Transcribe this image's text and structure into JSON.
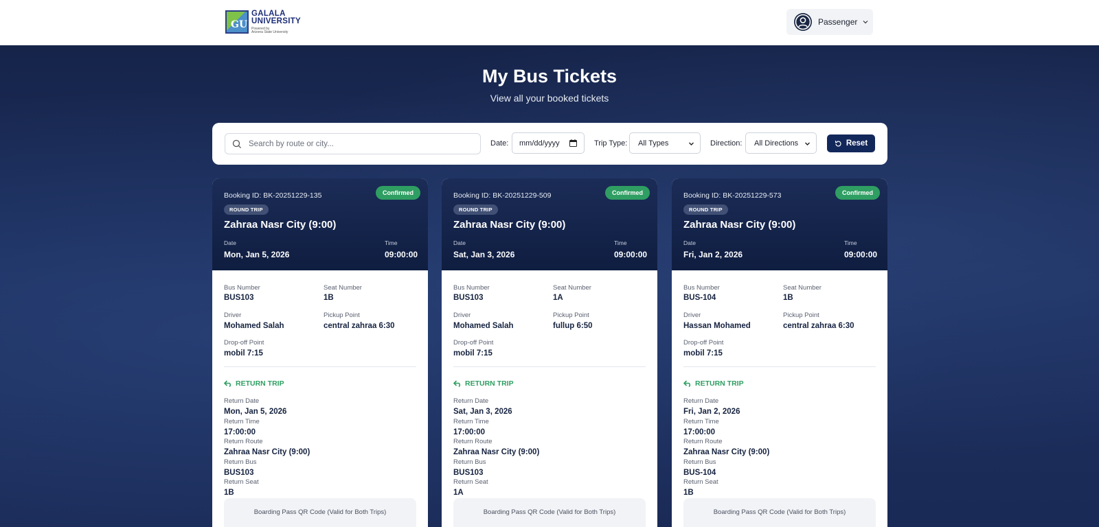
{
  "header": {
    "logo": {
      "mark": "GU",
      "line1": "GALALA",
      "line2": "UNIVERSITY",
      "line3": "Powered by",
      "line4": "Arizona State University"
    },
    "user_menu": {
      "label": "Passenger",
      "avatar_icon": "user-circle-icon",
      "chevron_icon": "chevron-down-icon"
    }
  },
  "page": {
    "title": "My Bus Tickets",
    "subtitle": "View all your booked tickets"
  },
  "filters": {
    "search_placeholder": "Search by route or city...",
    "date_label": "Date:",
    "date_placeholder": "mm/dd/yyyy",
    "trip_type_label": "Trip Type:",
    "trip_type_value": "All Types",
    "direction_label": "Direction:",
    "direction_value": "All Directions",
    "reset_label": "Reset"
  },
  "colors": {
    "navy": "#13285a",
    "confirmed": "#2f9e62",
    "return_green": "#2f9e62"
  },
  "labels": {
    "date": "Date",
    "time": "Time",
    "bus_number": "Bus Number",
    "seat_number": "Seat Number",
    "driver": "Driver",
    "pickup_point": "Pickup Point",
    "dropoff_point": "Drop-off Point",
    "return_trip": "RETURN TRIP",
    "return_date": "Return Date",
    "return_time": "Return Time",
    "return_route": "Return Route",
    "return_bus": "Return Bus",
    "return_seat": "Return Seat",
    "qr_title": "Boarding Pass QR Code (Valid for Both Trips)"
  },
  "tickets": [
    {
      "booking_id": "Booking ID: BK-20251229-135",
      "status": "Confirmed",
      "trip_type": "ROUND TRIP",
      "route": "Zahraa Nasr City (9:00)",
      "date": "Mon, Jan 5, 2026",
      "time": "09:00:00",
      "bus_number": "BUS103",
      "seat_number": "1B",
      "driver": "Mohamed Salah",
      "pickup_point": "central zahraa 6:30",
      "dropoff_point": "mobil 7:15",
      "return_date": "Mon, Jan 5, 2026",
      "return_time": "17:00:00",
      "return_route": "Zahraa Nasr City (9:00)",
      "return_bus": "BUS103",
      "return_seat": "1B"
    },
    {
      "booking_id": "Booking ID: BK-20251229-509",
      "status": "Confirmed",
      "trip_type": "ROUND TRIP",
      "route": "Zahraa Nasr City (9:00)",
      "date": "Sat, Jan 3, 2026",
      "time": "09:00:00",
      "bus_number": "BUS103",
      "seat_number": "1A",
      "driver": "Mohamed Salah",
      "pickup_point": "fullup 6:50",
      "dropoff_point": "mobil 7:15",
      "return_date": "Sat, Jan 3, 2026",
      "return_time": "17:00:00",
      "return_route": "Zahraa Nasr City (9:00)",
      "return_bus": "BUS103",
      "return_seat": "1A"
    },
    {
      "booking_id": "Booking ID: BK-20251229-573",
      "status": "Confirmed",
      "trip_type": "ROUND TRIP",
      "route": "Zahraa Nasr City (9:00)",
      "date": "Fri, Jan 2, 2026",
      "time": "09:00:00",
      "bus_number": "BUS-104",
      "seat_number": "1B",
      "driver": "Hassan Mohamed",
      "pickup_point": "central zahraa 6:30",
      "dropoff_point": "mobil 7:15",
      "return_date": "Fri, Jan 2, 2026",
      "return_time": "17:00:00",
      "return_route": "Zahraa Nasr City (9:00)",
      "return_bus": "BUS-104",
      "return_seat": "1B"
    }
  ]
}
